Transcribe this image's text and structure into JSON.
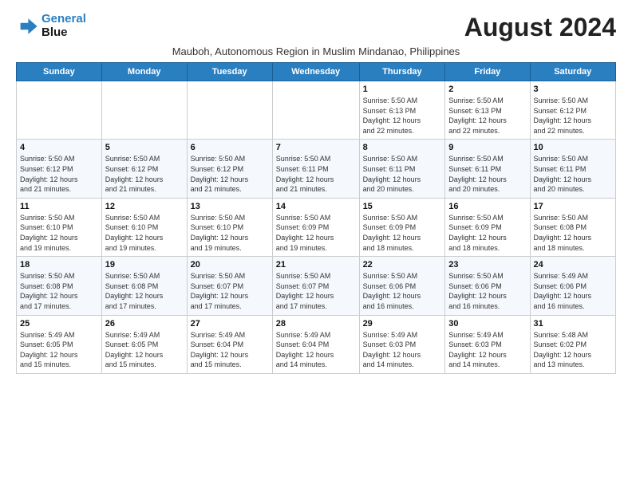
{
  "logo": {
    "line1": "General",
    "line2": "Blue"
  },
  "title": "August 2024",
  "subtitle": "Mauboh, Autonomous Region in Muslim Mindanao, Philippines",
  "days_of_week": [
    "Sunday",
    "Monday",
    "Tuesday",
    "Wednesday",
    "Thursday",
    "Friday",
    "Saturday"
  ],
  "weeks": [
    [
      {
        "num": "",
        "detail": ""
      },
      {
        "num": "",
        "detail": ""
      },
      {
        "num": "",
        "detail": ""
      },
      {
        "num": "",
        "detail": ""
      },
      {
        "num": "1",
        "detail": "Sunrise: 5:50 AM\nSunset: 6:13 PM\nDaylight: 12 hours\nand 22 minutes."
      },
      {
        "num": "2",
        "detail": "Sunrise: 5:50 AM\nSunset: 6:13 PM\nDaylight: 12 hours\nand 22 minutes."
      },
      {
        "num": "3",
        "detail": "Sunrise: 5:50 AM\nSunset: 6:12 PM\nDaylight: 12 hours\nand 22 minutes."
      }
    ],
    [
      {
        "num": "4",
        "detail": "Sunrise: 5:50 AM\nSunset: 6:12 PM\nDaylight: 12 hours\nand 21 minutes."
      },
      {
        "num": "5",
        "detail": "Sunrise: 5:50 AM\nSunset: 6:12 PM\nDaylight: 12 hours\nand 21 minutes."
      },
      {
        "num": "6",
        "detail": "Sunrise: 5:50 AM\nSunset: 6:12 PM\nDaylight: 12 hours\nand 21 minutes."
      },
      {
        "num": "7",
        "detail": "Sunrise: 5:50 AM\nSunset: 6:11 PM\nDaylight: 12 hours\nand 21 minutes."
      },
      {
        "num": "8",
        "detail": "Sunrise: 5:50 AM\nSunset: 6:11 PM\nDaylight: 12 hours\nand 20 minutes."
      },
      {
        "num": "9",
        "detail": "Sunrise: 5:50 AM\nSunset: 6:11 PM\nDaylight: 12 hours\nand 20 minutes."
      },
      {
        "num": "10",
        "detail": "Sunrise: 5:50 AM\nSunset: 6:11 PM\nDaylight: 12 hours\nand 20 minutes."
      }
    ],
    [
      {
        "num": "11",
        "detail": "Sunrise: 5:50 AM\nSunset: 6:10 PM\nDaylight: 12 hours\nand 19 minutes."
      },
      {
        "num": "12",
        "detail": "Sunrise: 5:50 AM\nSunset: 6:10 PM\nDaylight: 12 hours\nand 19 minutes."
      },
      {
        "num": "13",
        "detail": "Sunrise: 5:50 AM\nSunset: 6:10 PM\nDaylight: 12 hours\nand 19 minutes."
      },
      {
        "num": "14",
        "detail": "Sunrise: 5:50 AM\nSunset: 6:09 PM\nDaylight: 12 hours\nand 19 minutes."
      },
      {
        "num": "15",
        "detail": "Sunrise: 5:50 AM\nSunset: 6:09 PM\nDaylight: 12 hours\nand 18 minutes."
      },
      {
        "num": "16",
        "detail": "Sunrise: 5:50 AM\nSunset: 6:09 PM\nDaylight: 12 hours\nand 18 minutes."
      },
      {
        "num": "17",
        "detail": "Sunrise: 5:50 AM\nSunset: 6:08 PM\nDaylight: 12 hours\nand 18 minutes."
      }
    ],
    [
      {
        "num": "18",
        "detail": "Sunrise: 5:50 AM\nSunset: 6:08 PM\nDaylight: 12 hours\nand 17 minutes."
      },
      {
        "num": "19",
        "detail": "Sunrise: 5:50 AM\nSunset: 6:08 PM\nDaylight: 12 hours\nand 17 minutes."
      },
      {
        "num": "20",
        "detail": "Sunrise: 5:50 AM\nSunset: 6:07 PM\nDaylight: 12 hours\nand 17 minutes."
      },
      {
        "num": "21",
        "detail": "Sunrise: 5:50 AM\nSunset: 6:07 PM\nDaylight: 12 hours\nand 17 minutes."
      },
      {
        "num": "22",
        "detail": "Sunrise: 5:50 AM\nSunset: 6:06 PM\nDaylight: 12 hours\nand 16 minutes."
      },
      {
        "num": "23",
        "detail": "Sunrise: 5:50 AM\nSunset: 6:06 PM\nDaylight: 12 hours\nand 16 minutes."
      },
      {
        "num": "24",
        "detail": "Sunrise: 5:49 AM\nSunset: 6:06 PM\nDaylight: 12 hours\nand 16 minutes."
      }
    ],
    [
      {
        "num": "25",
        "detail": "Sunrise: 5:49 AM\nSunset: 6:05 PM\nDaylight: 12 hours\nand 15 minutes."
      },
      {
        "num": "26",
        "detail": "Sunrise: 5:49 AM\nSunset: 6:05 PM\nDaylight: 12 hours\nand 15 minutes."
      },
      {
        "num": "27",
        "detail": "Sunrise: 5:49 AM\nSunset: 6:04 PM\nDaylight: 12 hours\nand 15 minutes."
      },
      {
        "num": "28",
        "detail": "Sunrise: 5:49 AM\nSunset: 6:04 PM\nDaylight: 12 hours\nand 14 minutes."
      },
      {
        "num": "29",
        "detail": "Sunrise: 5:49 AM\nSunset: 6:03 PM\nDaylight: 12 hours\nand 14 minutes."
      },
      {
        "num": "30",
        "detail": "Sunrise: 5:49 AM\nSunset: 6:03 PM\nDaylight: 12 hours\nand 14 minutes."
      },
      {
        "num": "31",
        "detail": "Sunrise: 5:48 AM\nSunset: 6:02 PM\nDaylight: 12 hours\nand 13 minutes."
      }
    ]
  ]
}
